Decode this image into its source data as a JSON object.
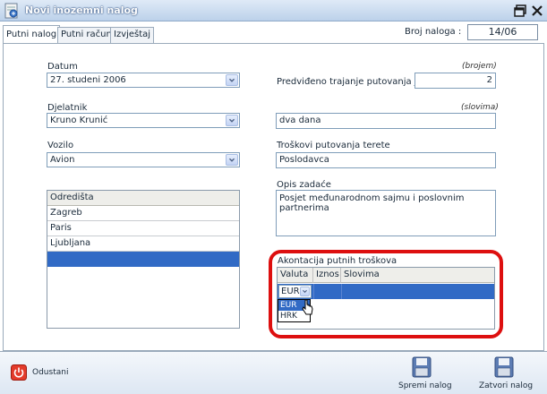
{
  "window": {
    "title": "Novi inozemni nalog",
    "accent": "#316ac5",
    "highlight": "#dd0f0f"
  },
  "tabs": [
    {
      "label": "Putni nalog",
      "active": true
    },
    {
      "label": "Putni račun",
      "active": false
    },
    {
      "label": "Izvještaj",
      "active": false
    }
  ],
  "header": {
    "broj_label": "Broj naloga :",
    "broj_value": "14/06"
  },
  "form": {
    "datum": {
      "label": "Datum",
      "value": "27. studeni 2006"
    },
    "djelatnik": {
      "label": "Djelatnik",
      "value": "Kruno Krunić"
    },
    "vozilo": {
      "label": "Vozilo",
      "value": "Avion"
    },
    "trajanje": {
      "label": "Predviđeno trajanje putovanja je",
      "hint_number": "(brojem)",
      "value": "2",
      "hint_words": "(slovima)",
      "value_words": "dva dana"
    },
    "troskovi": {
      "label": "Troškovi putovanja terete",
      "value": "Poslodavca"
    },
    "opis": {
      "label": "Opis zadaće",
      "value": "Posjet međunarodnom sajmu i poslovnim partnerima"
    }
  },
  "odredista": {
    "header": "Odredišta",
    "rows": [
      "Zagreb",
      "Paris",
      "Ljubljana"
    ]
  },
  "akontacija": {
    "label": "Akontacija putnih troškova",
    "columns": [
      "Valuta",
      "Iznos",
      "Slovima"
    ],
    "current_value": "EUR",
    "dropdown_options": [
      "EUR",
      "HRK"
    ]
  },
  "footer": {
    "cancel_label": "Odustani",
    "save_label": "Spremi nalog",
    "close_label": "Zatvori nalog"
  },
  "icons": {
    "app": "document-travel-icon",
    "restore": "restore-icon",
    "close": "close-icon",
    "cancel": "power-icon",
    "save": "floppy-disk-icon",
    "close_order": "floppy-disk-icon"
  }
}
